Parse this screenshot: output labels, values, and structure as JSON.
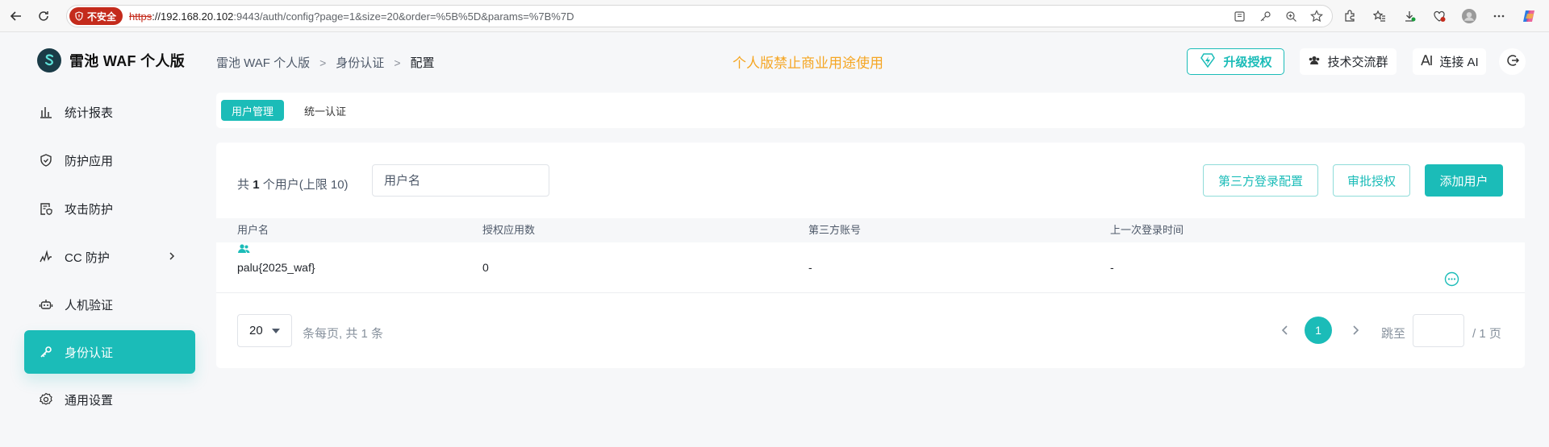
{
  "browser": {
    "security_label": "不安全",
    "url_scheme": "https",
    "url_host": "://192.168.20.102",
    "url_rest": ":9443/auth/config?page=1&size=20&order=%5B%5D&params=%7B%7D"
  },
  "app": {
    "name": "雷池 WAF 个人版"
  },
  "sidebar": {
    "items": [
      {
        "label": "统计报表",
        "icon": "bar-chart-icon"
      },
      {
        "label": "防护应用",
        "icon": "shield-icon"
      },
      {
        "label": "攻击防护",
        "icon": "clipboard-shield-icon"
      },
      {
        "label": "CC 防护",
        "icon": "pulse-icon"
      },
      {
        "label": "人机验证",
        "icon": "robot-icon"
      },
      {
        "label": "身份认证",
        "icon": "key-icon",
        "active": true
      },
      {
        "label": "通用设置",
        "icon": "gear-icon"
      }
    ]
  },
  "header": {
    "breadcrumb": [
      "雷池 WAF 个人版",
      "身份认证",
      "配置"
    ],
    "notice": "个人版禁止商业用途使用",
    "upgrade_label": "升级授权",
    "group_label": "技术交流群",
    "ai_label": "连接 AI"
  },
  "tabs": [
    "用户管理",
    "统一认证"
  ],
  "users": {
    "count_prefix": "共",
    "count": "1",
    "count_suffix": "个用户(上限 10)",
    "search_placeholder": "用户名",
    "thirdparty_button": "第三方登录配置",
    "approve_button": "审批授权",
    "add_button": "添加用户",
    "columns": [
      "用户名",
      "授权应用数",
      "第三方账号",
      "上一次登录时间"
    ],
    "rows": [
      {
        "username": "palu{2025_waf}",
        "apps": "0",
        "third_party": "-",
        "last_login": "-"
      }
    ]
  },
  "pagination": {
    "page_size": "20",
    "info": "条每页, 共 1 条",
    "current_page": "1",
    "jump_label": "跳至",
    "total_pages": "/ 1 页"
  },
  "colors": {
    "accent": "#1bbcb8",
    "notice": "#f5a623",
    "insecure": "#c42b1c"
  }
}
